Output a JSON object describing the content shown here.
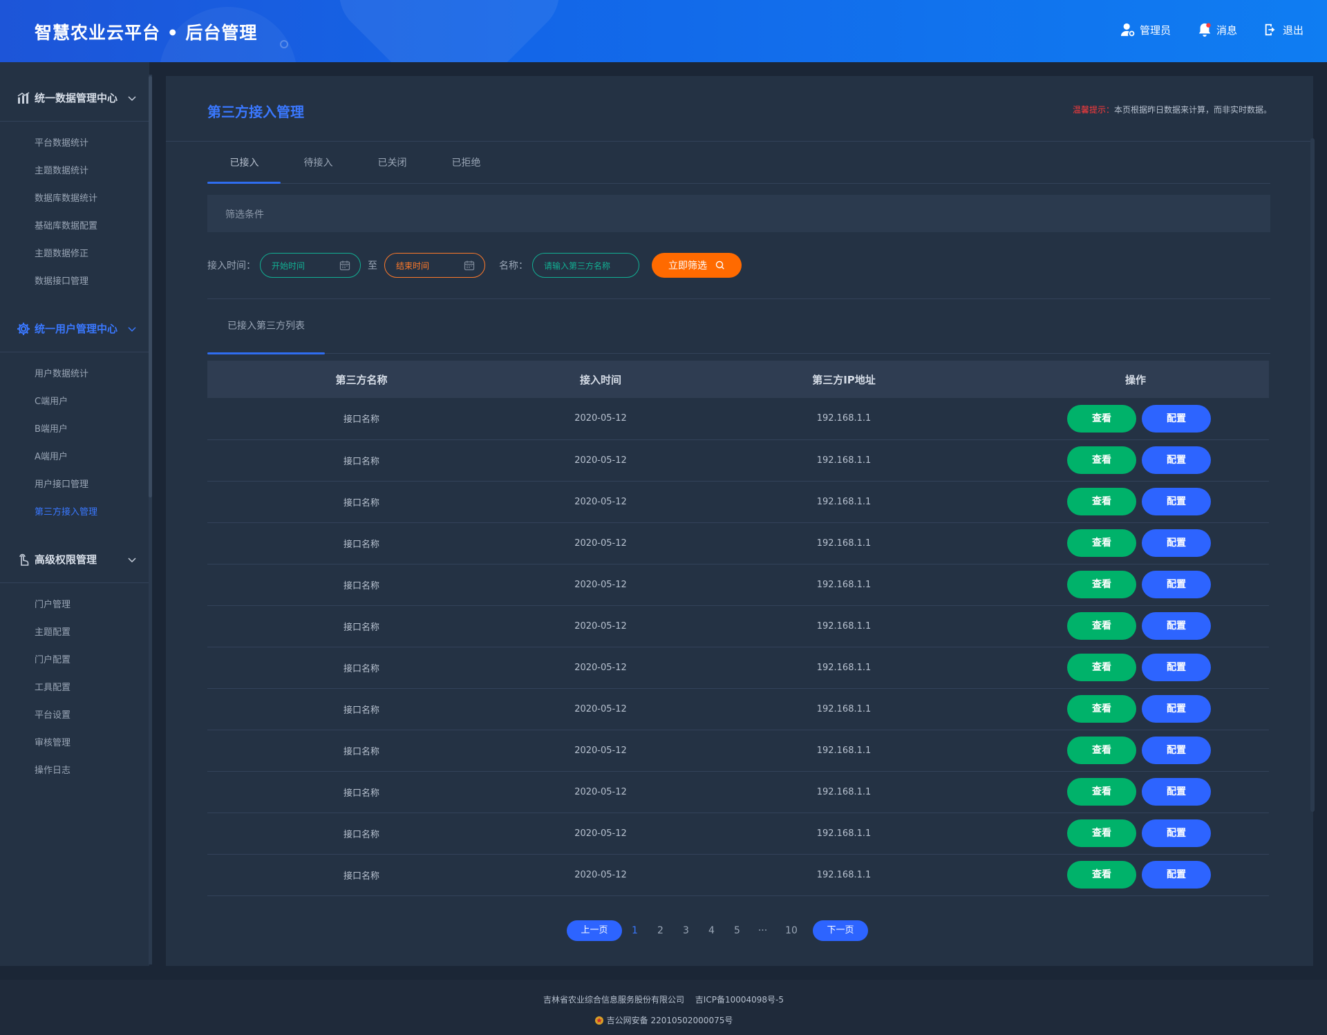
{
  "header": {
    "title": "智慧农业云平台 • 后台管理",
    "actions": [
      {
        "label": "管理员",
        "icon": "admin-user-icon"
      },
      {
        "label": "消息",
        "icon": "bell-icon"
      },
      {
        "label": "退出",
        "icon": "logout-icon"
      }
    ]
  },
  "sidebar": {
    "groups": [
      {
        "title": "统一数据管理中心",
        "icon": "chart-icon",
        "active": false,
        "items": [
          "平台数据统计",
          "主题数据统计",
          "数据库数据统计",
          "基础库数据配置",
          "主题数据修正",
          "数据接口管理"
        ]
      },
      {
        "title": "统一用户管理中心",
        "icon": "gear-icon",
        "active": true,
        "items": [
          "用户数据统计",
          "C端用户",
          "B端用户",
          "A端用户",
          "用户接口管理",
          "第三方接入管理"
        ]
      },
      {
        "title": "高级权限管理",
        "icon": "touch-hand-icon",
        "active": false,
        "items": [
          "门户管理",
          "主题配置",
          "门户配置",
          "工具配置",
          "平台设置",
          "审核管理",
          "操作日志"
        ]
      }
    ],
    "current_item": "第三方接入管理"
  },
  "main": {
    "page_title": "第三方接入管理",
    "notice_label": "温馨提示：",
    "notice_text": "本页根据昨日数据来计算，而非实时数据。",
    "tabs": [
      "已接入",
      "待接入",
      "已关闭",
      "已拒绝"
    ],
    "active_tab": "已接入",
    "filter_section_title": "筛选条件",
    "filters": {
      "time_label": "接入时间：",
      "start_placeholder": "开始时间",
      "to_label": "至",
      "end_placeholder": "结束时间",
      "name_label": "名称：",
      "name_placeholder": "请输入第三方名称",
      "submit_label": "立即筛选"
    },
    "list_title": "已接入第三方列表",
    "table": {
      "columns": [
        "第三方名称",
        "接入时间",
        "第三方IP地址",
        "操作"
      ],
      "rows": [
        {
          "name": "接口名称",
          "time": "2020-05-12",
          "ip": "192.168.1.1"
        },
        {
          "name": "接口名称",
          "time": "2020-05-12",
          "ip": "192.168.1.1"
        },
        {
          "name": "接口名称",
          "time": "2020-05-12",
          "ip": "192.168.1.1"
        },
        {
          "name": "接口名称",
          "time": "2020-05-12",
          "ip": "192.168.1.1"
        },
        {
          "name": "接口名称",
          "time": "2020-05-12",
          "ip": "192.168.1.1"
        },
        {
          "name": "接口名称",
          "time": "2020-05-12",
          "ip": "192.168.1.1"
        },
        {
          "name": "接口名称",
          "time": "2020-05-12",
          "ip": "192.168.1.1"
        },
        {
          "name": "接口名称",
          "time": "2020-05-12",
          "ip": "192.168.1.1"
        },
        {
          "name": "接口名称",
          "time": "2020-05-12",
          "ip": "192.168.1.1"
        },
        {
          "name": "接口名称",
          "time": "2020-05-12",
          "ip": "192.168.1.1"
        },
        {
          "name": "接口名称",
          "time": "2020-05-12",
          "ip": "192.168.1.1"
        },
        {
          "name": "接口名称",
          "time": "2020-05-12",
          "ip": "192.168.1.1"
        }
      ],
      "view_label": "查看",
      "config_label": "配置"
    },
    "pagination": {
      "prev_label": "上一页",
      "pages": [
        "1",
        "2",
        "3",
        "4",
        "5",
        "···",
        "10"
      ],
      "current_page": "1",
      "next_label": "下一页"
    }
  },
  "footer": {
    "line1": "吉林省农业综合信息服务股份有限公司　 吉ICP备10004098号-5",
    "line2": "吉公网安备 22010502000075号"
  },
  "colors": {
    "accent": "#2d64ff",
    "view_button": "#00b26a",
    "search_button": "#ff6a00",
    "start_input": "#12b094",
    "end_input": "#ff7a2a",
    "warning": "#ff3b3b"
  }
}
